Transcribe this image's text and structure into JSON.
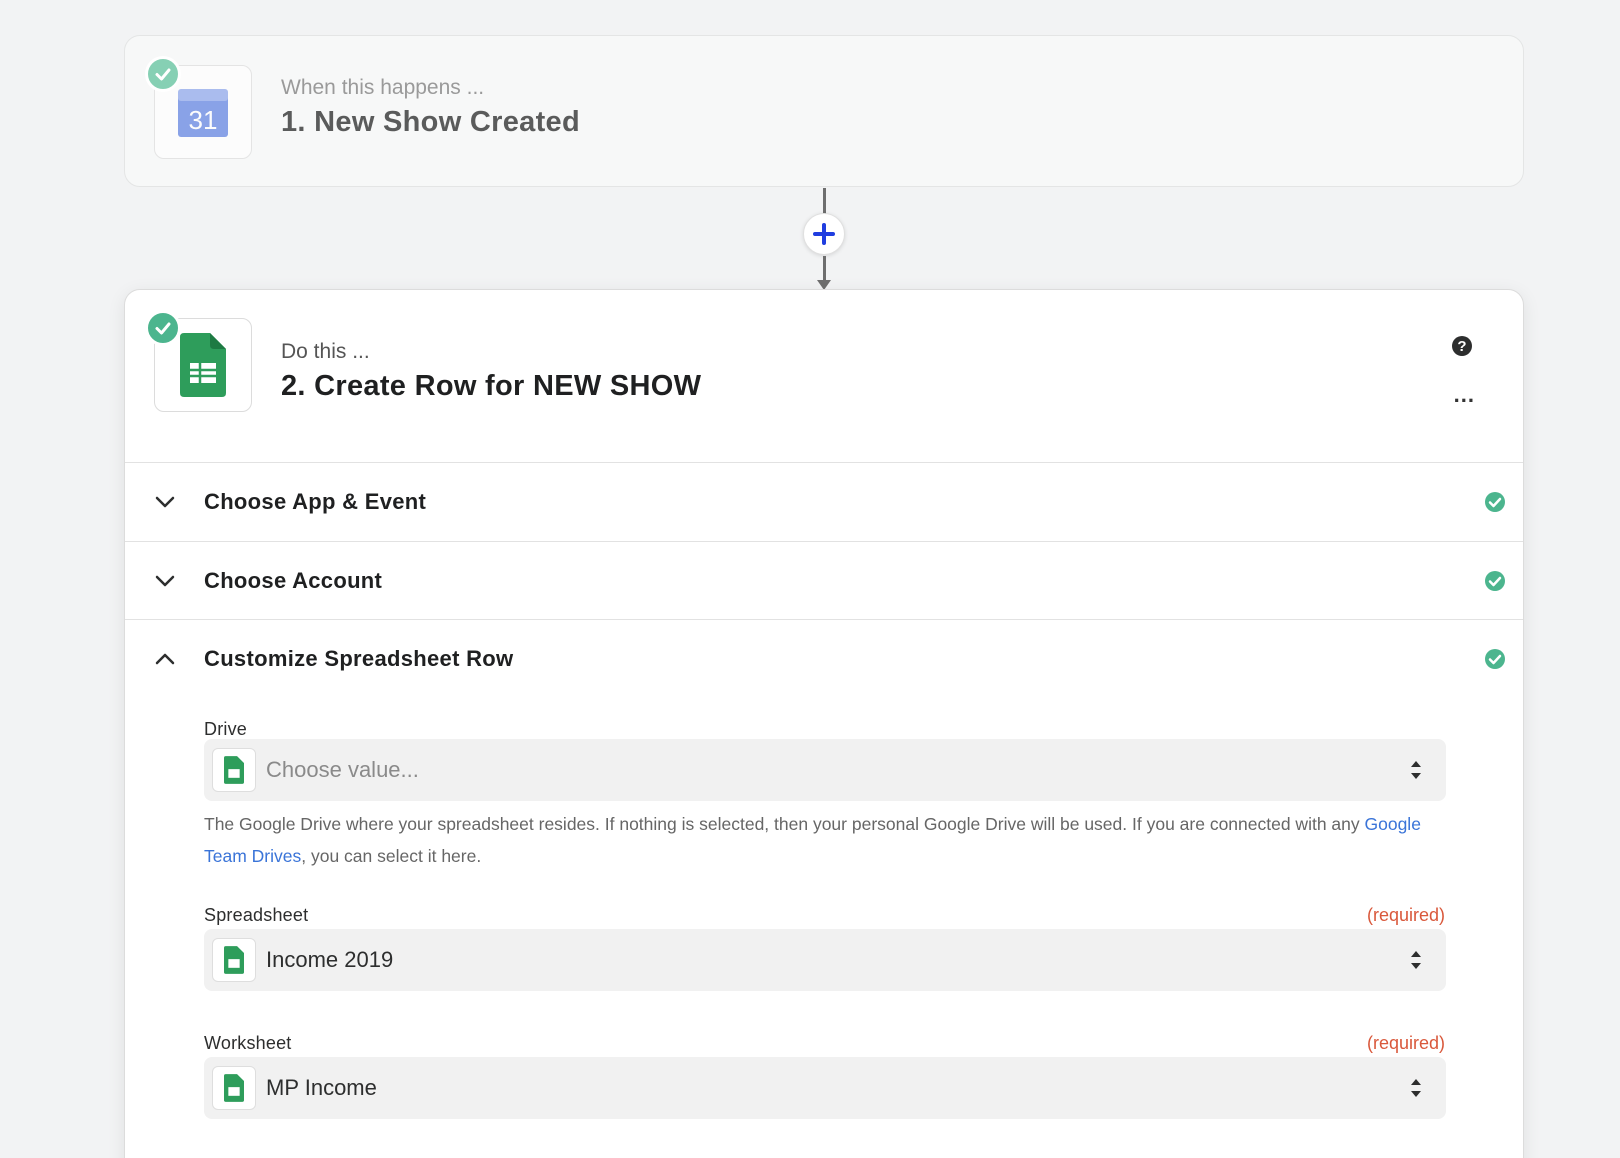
{
  "trigger": {
    "subtitle": "When this happens ...",
    "title": "1. New Show Created",
    "app_icon": "google-calendar-icon",
    "calendar_day": "31"
  },
  "connector": {
    "add_icon": "plus-icon"
  },
  "action": {
    "subtitle": "Do this ...",
    "title": "2. Create Row for NEW SHOW",
    "app_icon": "google-sheets-icon",
    "more_label": "..."
  },
  "sections": [
    {
      "label": "Choose App & Event",
      "state": "collapsed",
      "complete": true
    },
    {
      "label": "Choose Account",
      "state": "collapsed",
      "complete": true
    },
    {
      "label": "Customize Spreadsheet Row",
      "state": "expanded",
      "complete": true
    }
  ],
  "fields": {
    "drive": {
      "label": "Drive",
      "placeholder": "Choose value...",
      "help_before": "The Google Drive where your spreadsheet resides. If nothing is selected, then your personal Google Drive will be used. If you are connected with any ",
      "help_link": "Google Team Drives",
      "help_after": ", you can select it here."
    },
    "spreadsheet": {
      "label": "Spreadsheet",
      "required": "(required)",
      "value": "Income 2019"
    },
    "worksheet": {
      "label": "Worksheet",
      "required": "(required)",
      "value": "MP Income"
    }
  },
  "colors": {
    "success": "#4cb58e",
    "link": "#3a74d8",
    "required": "#d9583b",
    "accent_blue": "#1f3de0",
    "sheets_green": "#2e9d5b",
    "calendar_blue": "#5b7fe0"
  }
}
